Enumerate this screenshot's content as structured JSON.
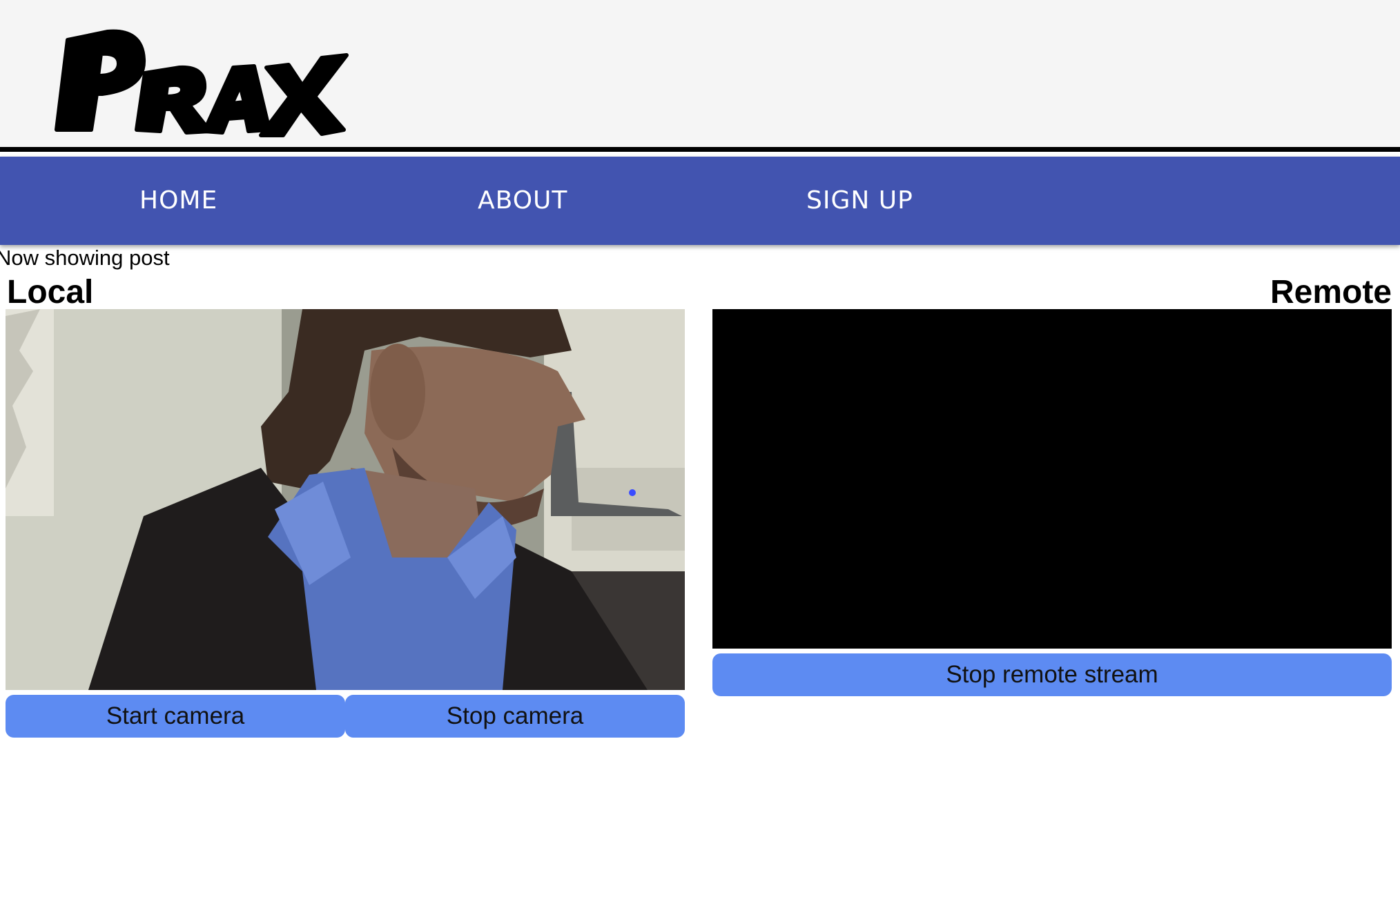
{
  "header": {
    "logo_text": "PRAX"
  },
  "nav": {
    "items": [
      {
        "label": "HOME"
      },
      {
        "label": "ABOUT"
      },
      {
        "label": "SIGN UP"
      }
    ]
  },
  "main": {
    "status_text": "Now showing post",
    "local": {
      "title": "Local",
      "start_button": "Start camera",
      "stop_button": "Stop camera"
    },
    "remote": {
      "title": "Remote",
      "stop_button": "Stop remote stream"
    }
  },
  "colors": {
    "header_bg": "#f5f5f5",
    "nav_bg": "#4254b0",
    "button_bg": "#5d8bf2",
    "remote_video_bg": "#000000"
  }
}
